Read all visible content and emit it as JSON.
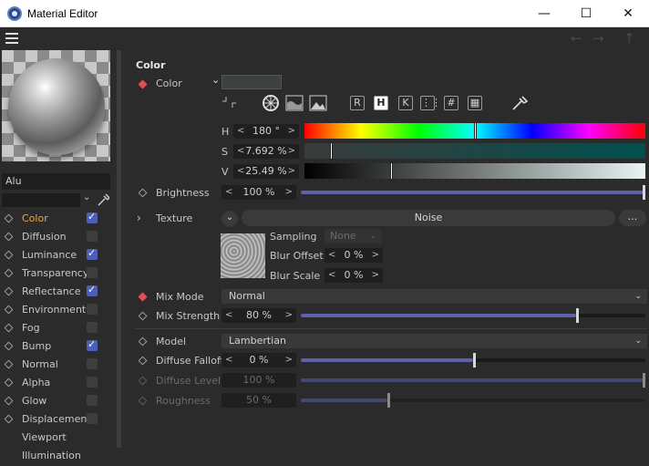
{
  "window": {
    "title": "Material Editor",
    "min": "—",
    "max": "☐",
    "close": "✕"
  },
  "left": {
    "material_name": "Alu",
    "channels": [
      {
        "label": "Color",
        "checked": true,
        "active": true
      },
      {
        "label": "Diffusion",
        "checked": false
      },
      {
        "label": "Luminance",
        "checked": true
      },
      {
        "label": "Transparency",
        "checked": false
      },
      {
        "label": "Reflectance",
        "checked": true
      },
      {
        "label": "Environment",
        "checked": false
      },
      {
        "label": "Fog",
        "checked": false
      },
      {
        "label": "Bump",
        "checked": true
      },
      {
        "label": "Normal",
        "checked": false
      },
      {
        "label": "Alpha",
        "checked": false
      },
      {
        "label": "Glow",
        "checked": false
      },
      {
        "label": "Displacement",
        "checked": false
      },
      {
        "label": "Viewport"
      },
      {
        "label": "Illumination"
      }
    ]
  },
  "main": {
    "section_title": "Color",
    "color_label": "Color",
    "swatch_color": "#3d4141",
    "modes": [
      "R",
      "H",
      "K",
      "⋮⋮",
      "#",
      "▦"
    ],
    "h": {
      "label": "H",
      "value": "180 °",
      "fraction": 0.5
    },
    "s": {
      "label": "S",
      "value": "7.692 %",
      "fraction": 0.077
    },
    "v": {
      "label": "V",
      "value": "25.49 %",
      "fraction": 0.255
    },
    "brightness": {
      "label": "Brightness",
      "value": "100 %",
      "fraction": 1.0
    },
    "texture": {
      "label": "Texture",
      "value": "Noise",
      "more": "..."
    },
    "sampling": {
      "label": "Sampling",
      "value": "None"
    },
    "blur_offset": {
      "label": "Blur Offset",
      "value": "0 %"
    },
    "blur_scale": {
      "label": "Blur Scale",
      "value": "0 %"
    },
    "mix_mode": {
      "label": "Mix Mode",
      "value": "Normal"
    },
    "mix_strength": {
      "label": "Mix Strength",
      "value": "80 %",
      "fraction": 0.8
    },
    "model": {
      "label": "Model",
      "value": "Lambertian"
    },
    "diffuse_falloff": {
      "label": "Diffuse Falloff",
      "value": "0 %",
      "fraction": 0.5
    },
    "diffuse_level": {
      "label": "Diffuse Level",
      "value": "100 %",
      "fraction": 1.0
    },
    "roughness": {
      "label": "Roughness",
      "value": "50 %",
      "fraction": 0.25
    }
  }
}
